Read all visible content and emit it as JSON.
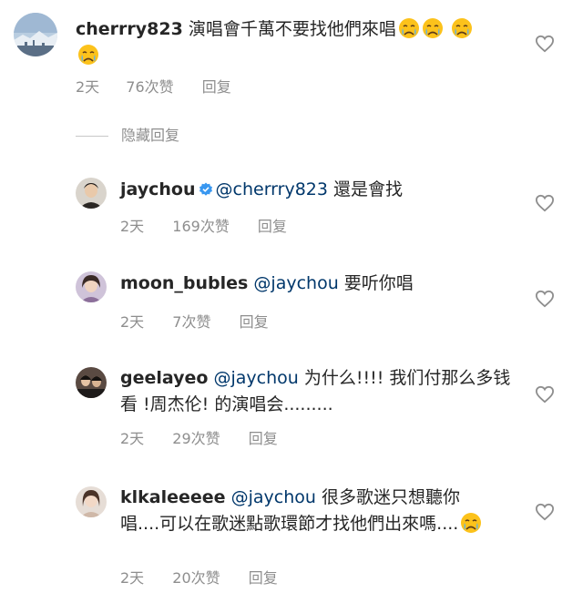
{
  "comments": [
    {
      "username": "cherrry823",
      "mention": "",
      "text": "演唱會千萬不要找他們來唱",
      "emoji": [
        "crying-face",
        "crying-face",
        "crying-face",
        "crying-face"
      ],
      "time": "2天",
      "likes": "76次赞",
      "reply": "回复"
    },
    {
      "username": "jaychou",
      "verified": true,
      "mention": "@cherrry823",
      "text": "還是會找",
      "time": "2天",
      "likes": "169次赞",
      "reply": "回复"
    },
    {
      "username": "moon_bubles",
      "mention": "@jaychou",
      "text": "要听你唱",
      "time": "2天",
      "likes": "7次赞",
      "reply": "回复"
    },
    {
      "username": "geelayeo",
      "mention": "@jaychou",
      "text": "为什么!!!! 我们付那么多钱看 !周杰伦! 的演唱会.........",
      "time": "2天",
      "likes": "29次赞",
      "reply": "回复"
    },
    {
      "username": "klkaleeeee",
      "mention": "@jaychou",
      "text": "很多歌迷只想聽你唱....可以在歌迷點歌環節才找他們出來嗎....",
      "emoji": [
        "crying-face"
      ],
      "time": "2天",
      "likes": "20次赞",
      "reply": "回复"
    }
  ],
  "hide_replies_label": "隐藏回复",
  "colors": {
    "text": "#262626",
    "mention": "#00376b",
    "meta": "#8e8e8e",
    "verified": "#3897f0"
  }
}
